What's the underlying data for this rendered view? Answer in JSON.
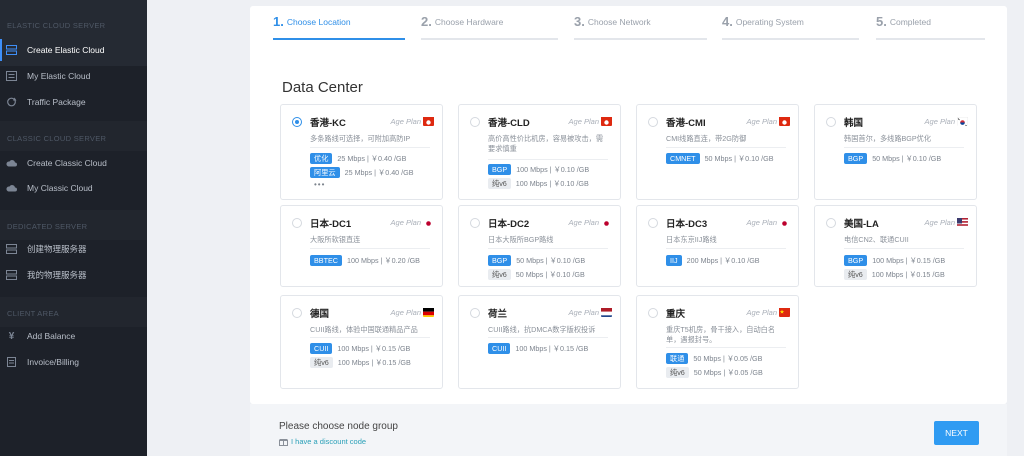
{
  "sidebar": {
    "sections": [
      {
        "title": "ELASTIC CLOUD SERVER"
      },
      {
        "title": "CLASSIC CLOUD SERVER"
      },
      {
        "title": "DEDICATED SERVER"
      },
      {
        "title": "CLIENT AREA"
      }
    ],
    "items": [
      {
        "label": "Create Elastic Cloud",
        "icon": "server-icon",
        "active": true
      },
      {
        "label": "My Elastic Cloud",
        "icon": "list-icon"
      },
      {
        "label": "Traffic Package",
        "icon": "refresh-icon"
      },
      {
        "label": "Create Classic Cloud",
        "icon": "cloud-icon"
      },
      {
        "label": "My Classic Cloud",
        "icon": "cloud-icon"
      },
      {
        "label": "创建物理服务器",
        "icon": "server-icon"
      },
      {
        "label": "我的物理服务器",
        "icon": "server-icon"
      },
      {
        "label": "Add Balance",
        "icon": "yen-icon"
      },
      {
        "label": "Invoice/Billing",
        "icon": "document-icon"
      }
    ]
  },
  "steps": [
    {
      "num": "1.",
      "label": "Choose Location",
      "active": true
    },
    {
      "num": "2.",
      "label": "Choose Hardware"
    },
    {
      "num": "3.",
      "label": "Choose Network"
    },
    {
      "num": "4.",
      "label": "Operating System"
    },
    {
      "num": "5.",
      "label": "Completed"
    }
  ],
  "section_title": "Data Center",
  "plan_label": "Age Plan",
  "datacenters": [
    {
      "name": "香港-KC",
      "flag": "hk-flag",
      "selected": true,
      "desc": "多条路线可选择，可附加高防IP",
      "lines": [
        {
          "tag": "优化",
          "tag_style": "blue",
          "text": "25 Mbps | ￥0.40 /GB"
        },
        {
          "tag": "阿里云",
          "tag_style": "blue",
          "text": "25 Mbps | ￥0.40 /GB"
        }
      ],
      "more": "•••"
    },
    {
      "name": "香港-CLD",
      "flag": "hk-flag",
      "desc": "高价高性价比机房，容易被攻击，需要求慎重",
      "lines": [
        {
          "tag": "BGP",
          "tag_style": "blue",
          "text": "100 Mbps | ￥0.10 /GB"
        },
        {
          "tag": "纯v6",
          "tag_style": "grey",
          "text": "100 Mbps | ￥0.10 /GB"
        }
      ]
    },
    {
      "name": "香港-CMI",
      "flag": "hk-flag",
      "desc": "CMI线路直连，带2G防御",
      "lines": [
        {
          "tag": "CMNET",
          "tag_style": "blue",
          "text": "50 Mbps | ￥0.10 /GB"
        }
      ]
    },
    {
      "name": "韩国",
      "flag": "kr-flag",
      "desc": "韩国首尔，多线路BGP优化",
      "lines": [
        {
          "tag": "BGP",
          "tag_style": "blue",
          "text": "50 Mbps | ￥0.10 /GB"
        }
      ]
    },
    {
      "name": "日本-DC1",
      "flag": "jp-flag",
      "desc": "大阪所软银直连",
      "lines": [
        {
          "tag": "BBTEC",
          "tag_style": "blue",
          "text": "100 Mbps | ￥0.20 /GB"
        }
      ]
    },
    {
      "name": "日本-DC2",
      "flag": "jp-flag",
      "desc": "日本大阪所BGP路线",
      "lines": [
        {
          "tag": "BGP",
          "tag_style": "blue",
          "text": "50 Mbps | ￥0.10 /GB"
        },
        {
          "tag": "纯v6",
          "tag_style": "grey",
          "text": "50 Mbps | ￥0.10 /GB"
        }
      ]
    },
    {
      "name": "日本-DC3",
      "flag": "jp-flag",
      "desc": "日本东京IIJ路线",
      "lines": [
        {
          "tag": "IIJ",
          "tag_style": "blue",
          "text": "200 Mbps | ￥0.10 /GB"
        }
      ]
    },
    {
      "name": "美国-LA",
      "flag": "us-flag",
      "desc": "电信CN2、联通CUII",
      "lines": [
        {
          "tag": "BGP",
          "tag_style": "blue",
          "text": "100 Mbps | ￥0.15 /GB"
        },
        {
          "tag": "纯v6",
          "tag_style": "grey",
          "text": "100 Mbps | ￥0.15 /GB"
        }
      ]
    },
    {
      "name": "德国",
      "flag": "de-flag",
      "desc": "CUII路线，体验中国联通精品产品",
      "lines": [
        {
          "tag": "CUII",
          "tag_style": "blue",
          "text": "100 Mbps | ￥0.15 /GB"
        },
        {
          "tag": "纯v6",
          "tag_style": "grey",
          "text": "100 Mbps | ￥0.15 /GB"
        }
      ]
    },
    {
      "name": "荷兰",
      "flag": "nl-flag",
      "desc": "CUII路线，抗DMCA数字版权投诉",
      "lines": [
        {
          "tag": "CUII",
          "tag_style": "blue",
          "text": "100 Mbps | ￥0.15 /GB"
        }
      ]
    },
    {
      "name": "重庆",
      "flag": "cn-flag",
      "desc": "重庆T5机房，骨干接入，自动白名单，遇报封号。",
      "lines": [
        {
          "tag": "联通",
          "tag_style": "blue",
          "text": "50 Mbps | ￥0.05 /GB"
        },
        {
          "tag": "纯v6",
          "tag_style": "grey",
          "text": "50 Mbps | ￥0.05 /GB"
        }
      ]
    }
  ],
  "footer": {
    "message": "Please choose node group",
    "discount": "I have a discount code",
    "next": "NEXT"
  },
  "colors": {
    "accent": "#2f8fe8",
    "sidebar_bg": "#1d2129"
  }
}
